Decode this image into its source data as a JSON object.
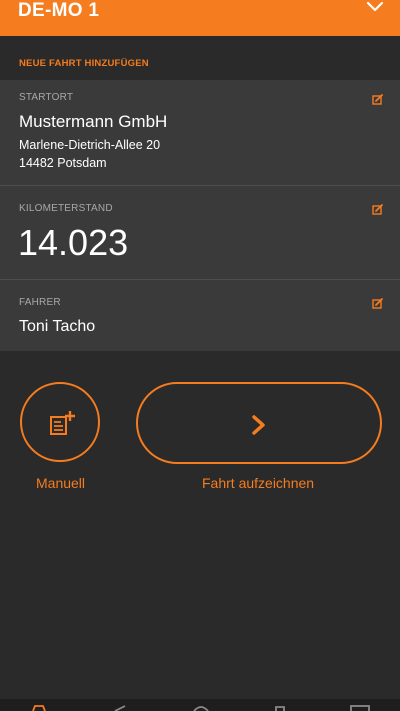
{
  "header": {
    "title": "DE-MO 1",
    "chevron_icon": "chevron-down-icon"
  },
  "section": {
    "title": "NEUE FAHRT HINZUFÜGEN"
  },
  "start": {
    "label": "STARTORT",
    "company": "Mustermann GmbH",
    "street": "Marlene-Dietrich-Allee 20",
    "city": "14482 Potsdam",
    "edit_icon": "edit-icon"
  },
  "mileage": {
    "label": "KILOMETERSTAND",
    "value": "14.023",
    "edit_icon": "edit-icon"
  },
  "driver": {
    "label": "FAHRER",
    "name": "Toni Tacho",
    "edit_icon": "edit-icon"
  },
  "actions": {
    "manual_label": "Manuell",
    "manual_icon": "add-document-icon",
    "record_label": "Fahrt aufzeichnen",
    "record_icon": "chevron-right-icon"
  },
  "colors": {
    "accent": "#f57c1f",
    "background": "#2a2a2a",
    "card": "#3a3a3a"
  },
  "bottom_nav": {
    "icons": [
      "car-icon",
      "navigation-icon",
      "dashboard-icon",
      "settings-icon",
      "list-icon"
    ]
  }
}
